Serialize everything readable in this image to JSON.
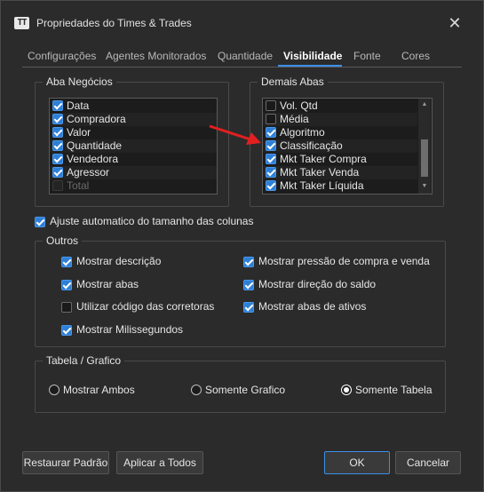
{
  "window": {
    "title": "Propriedades do Times & Trades",
    "icon_text": "TT",
    "close_glyph": "✕"
  },
  "tabs": [
    {
      "label": "Configurações",
      "active": false
    },
    {
      "label": "Agentes Monitorados",
      "active": false
    },
    {
      "label": "Quantidade",
      "active": false
    },
    {
      "label": "Visibilidade",
      "active": true
    },
    {
      "label": "Fonte",
      "active": false
    },
    {
      "label": "Cores",
      "active": false
    }
  ],
  "aba_negocios": {
    "title": "Aba Negócios",
    "items": [
      {
        "label": "Data",
        "checked": true,
        "enabled": true
      },
      {
        "label": "Compradora",
        "checked": true,
        "enabled": true
      },
      {
        "label": "Valor",
        "checked": true,
        "enabled": true
      },
      {
        "label": "Quantidade",
        "checked": true,
        "enabled": true
      },
      {
        "label": "Vendedora",
        "checked": true,
        "enabled": true
      },
      {
        "label": "Agressor",
        "checked": true,
        "enabled": true
      },
      {
        "label": "Total",
        "checked": false,
        "enabled": false
      }
    ]
  },
  "demais_abas": {
    "title": "Demais Abas",
    "items": [
      {
        "label": "Vol. Qtd",
        "checked": false
      },
      {
        "label": "Média",
        "checked": false
      },
      {
        "label": "Algoritmo",
        "checked": true
      },
      {
        "label": "Classificação",
        "checked": true
      },
      {
        "label": "Mkt Taker Compra",
        "checked": true
      },
      {
        "label": "Mkt Taker Venda",
        "checked": true
      },
      {
        "label": "Mkt Taker Líquida",
        "checked": true
      }
    ]
  },
  "ajuste": {
    "label": "Ajuste automatico do tamanho das colunas",
    "checked": true
  },
  "outros": {
    "title": "Outros",
    "left": [
      {
        "label": "Mostrar descrição",
        "checked": true
      },
      {
        "label": "Mostrar abas",
        "checked": true
      },
      {
        "label": "Utilizar código das corretoras",
        "checked": false
      },
      {
        "label": "Mostrar Milissegundos",
        "checked": true
      }
    ],
    "right": [
      {
        "label": "Mostrar pressão de compra e venda",
        "checked": true
      },
      {
        "label": "Mostrar direção do saldo",
        "checked": true
      },
      {
        "label": "Mostrar abas de ativos",
        "checked": true
      }
    ]
  },
  "tabela_grafico": {
    "title": "Tabela / Grafico",
    "options": [
      {
        "label": "Mostrar Ambos",
        "selected": false
      },
      {
        "label": "Somente Grafico",
        "selected": false
      },
      {
        "label": "Somente Tabela",
        "selected": true
      }
    ]
  },
  "buttons": {
    "restore": "Restaurar Padrão",
    "apply_all": "Aplicar a Todos",
    "ok": "OK",
    "cancel": "Cancelar"
  },
  "colors": {
    "accent": "#3d8ee8",
    "annotation_arrow": "#e02020",
    "background": "#2b2b2b"
  }
}
